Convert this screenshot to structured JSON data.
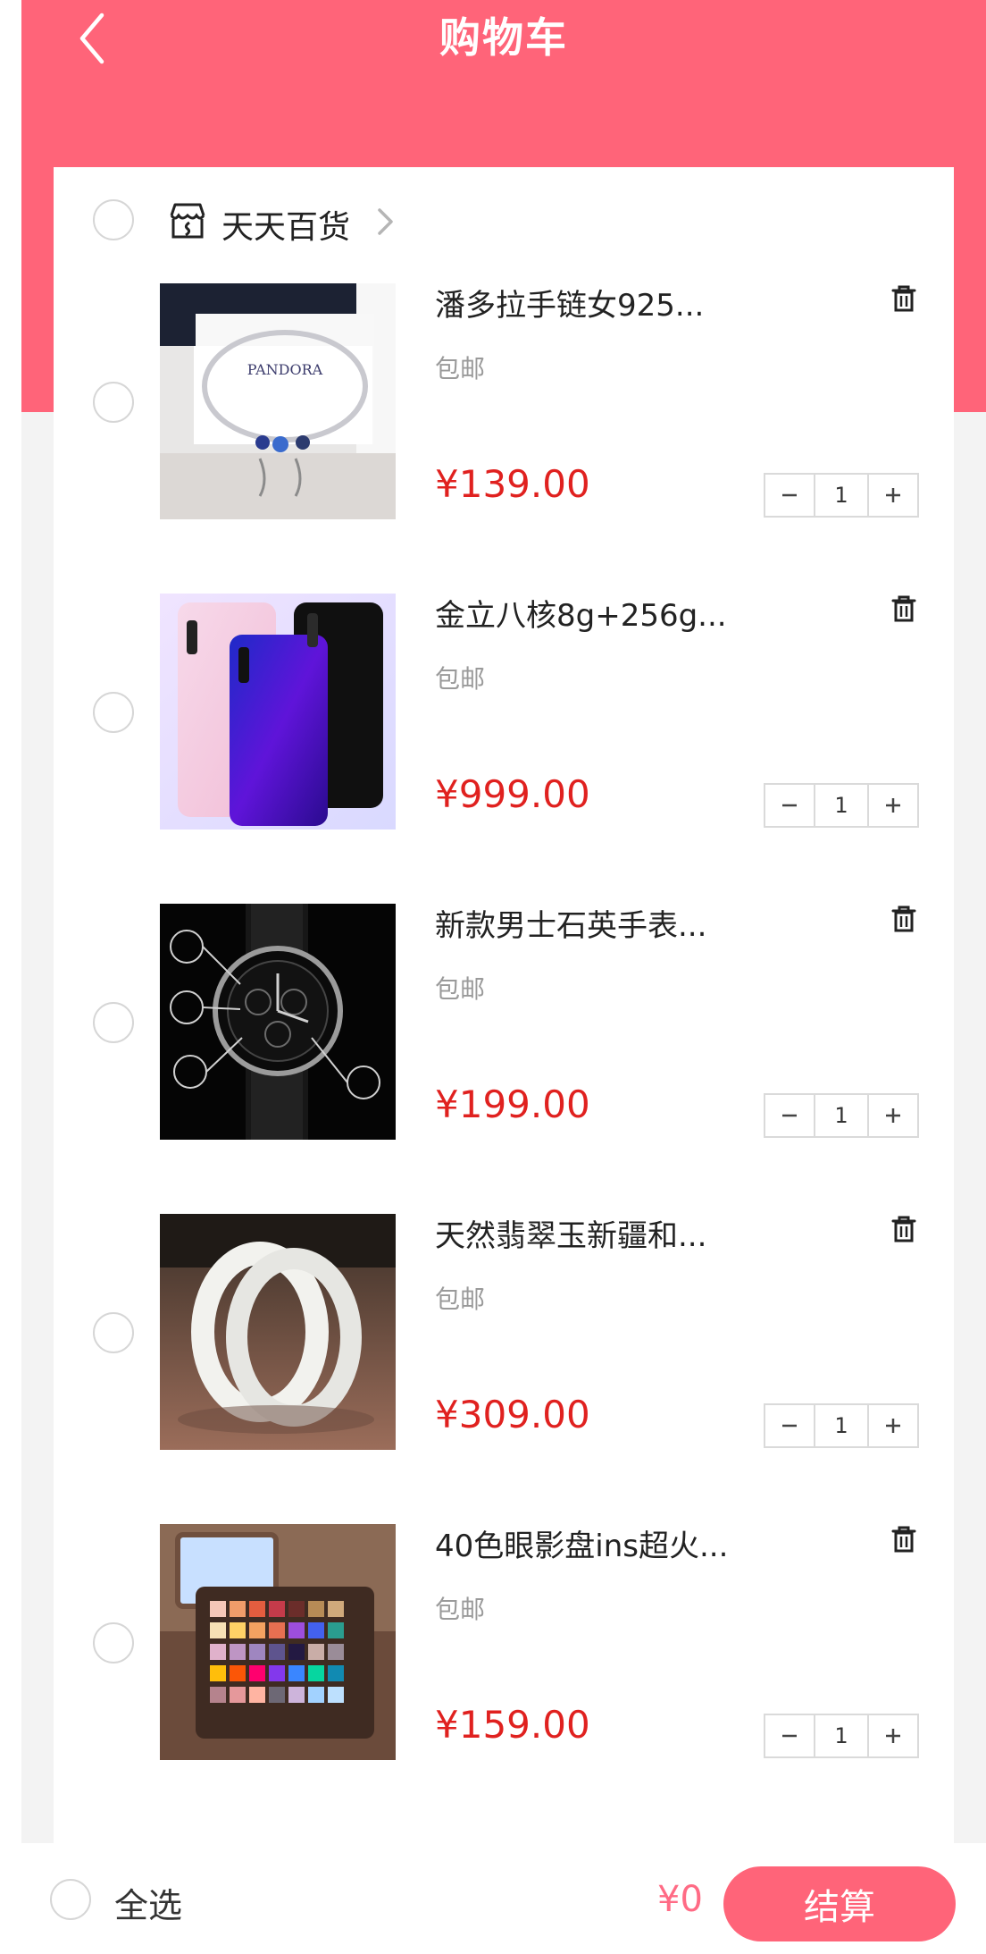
{
  "theme": {
    "brand": "#ff6479",
    "price": "#e0211f",
    "total": "#ff6b85"
  },
  "header": {
    "title": "购物车",
    "back_icon": "back-chevron-icon"
  },
  "store": {
    "name": "天天百货",
    "icon": "store-icon",
    "arrow_icon": "chevron-right-icon"
  },
  "items": [
    {
      "title": "潘多拉手链女925...",
      "shipping": "包邮",
      "price": "¥139.00",
      "quantity": "1",
      "image": "bracelet-product-image"
    },
    {
      "title": "金立八核8g+256g...",
      "shipping": "包邮",
      "price": "¥999.00",
      "quantity": "1",
      "image": "phones-product-image"
    },
    {
      "title": "新款男士石英手表...",
      "shipping": "包邮",
      "price": "¥199.00",
      "quantity": "1",
      "image": "watch-product-image"
    },
    {
      "title": "天然翡翠玉新疆和...",
      "shipping": "包邮",
      "price": "¥309.00",
      "quantity": "1",
      "image": "jade-bangle-product-image"
    },
    {
      "title": "40色眼影盘ins超火...",
      "shipping": "包邮",
      "price": "¥159.00",
      "quantity": "1",
      "image": "eyeshadow-palette-product-image"
    }
  ],
  "footer": {
    "select_all_label": "全选",
    "total": "¥0",
    "checkout_label": "结算"
  }
}
